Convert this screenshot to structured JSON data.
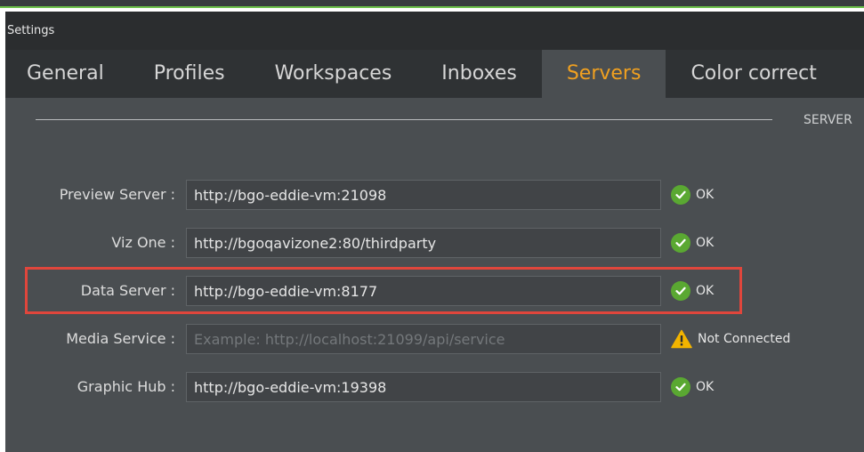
{
  "window": {
    "title": "Settings"
  },
  "tabs": [
    {
      "label": "General",
      "active": false
    },
    {
      "label": "Profiles",
      "active": false
    },
    {
      "label": "Workspaces",
      "active": false
    },
    {
      "label": "Inboxes",
      "active": false
    },
    {
      "label": "Servers",
      "active": true
    },
    {
      "label": "Color correct",
      "active": false
    }
  ],
  "section": {
    "label": "SERVER"
  },
  "servers": [
    {
      "label": "Preview Server :",
      "value": "http://bgo-eddie-vm:21098",
      "placeholder": "",
      "status": "OK",
      "status_icon": "check-circle-icon"
    },
    {
      "label": "Viz One :",
      "value": "http://bgoqavizone2:80/thirdparty",
      "placeholder": "",
      "status": "OK",
      "status_icon": "check-circle-icon"
    },
    {
      "label": "Data Server :",
      "value": "http://bgo-eddie-vm:8177",
      "placeholder": "",
      "status": "OK",
      "status_icon": "check-circle-icon",
      "highlighted": true
    },
    {
      "label": "Media Service :",
      "value": "",
      "placeholder": "Example: http://localhost:21099/api/service",
      "status": "Not Connected",
      "status_icon": "warning-icon"
    },
    {
      "label": "Graphic Hub :",
      "value": "http://bgo-eddie-vm:19398",
      "placeholder": "",
      "status": "OK",
      "status_icon": "check-circle-icon"
    }
  ],
  "colors": {
    "active_tab": "#f0a020",
    "ok_green": "#5aa832",
    "warning_yellow": "#f2b400",
    "highlight_red": "#e0463c",
    "accent_green": "#6cc04a"
  }
}
